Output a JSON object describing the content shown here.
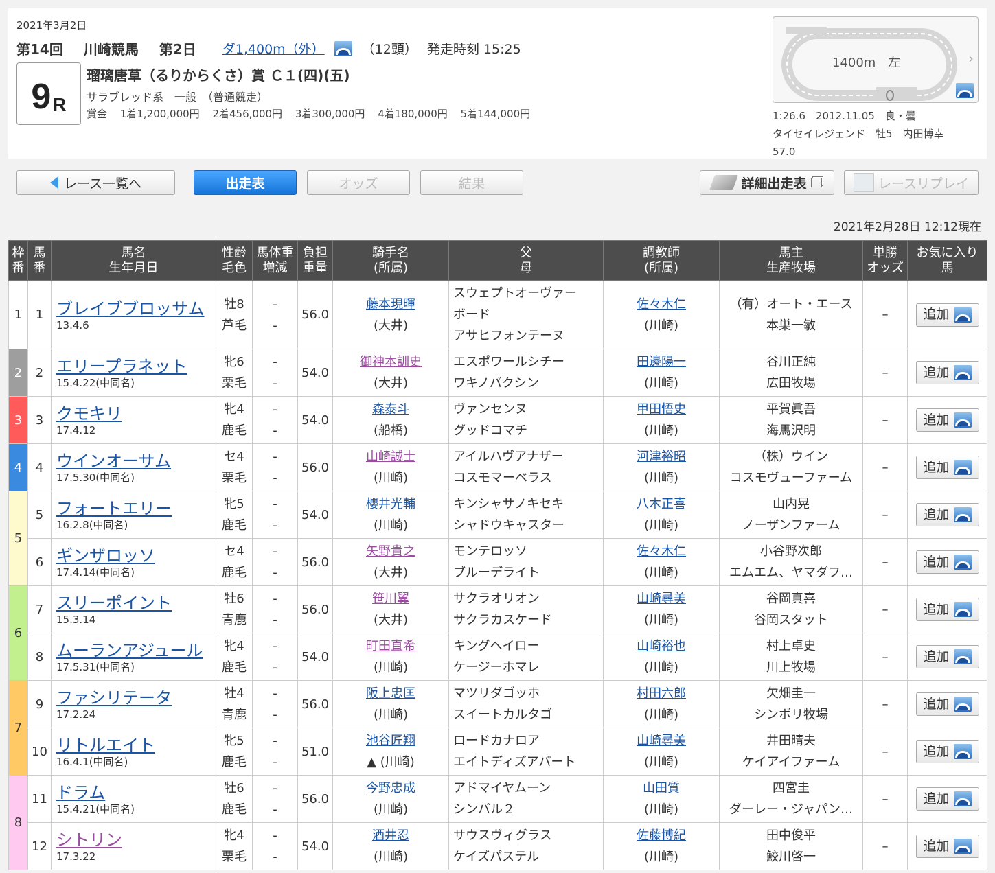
{
  "race": {
    "date": "2021年3月2日",
    "kai": "第14回",
    "venue": "川崎競馬",
    "day": "第2日",
    "distance": "ダ1,400m（外）",
    "count": "（12頭）",
    "post": "発走時刻 15:25",
    "number": "9",
    "r": "R",
    "name": "瑠璃唐草（るりからくさ）賞 Ｃ１(四)(五)",
    "class": "サラブレッド系　一般　（普通競走）",
    "prize_label": "賞金",
    "prizes": [
      "1着1,200,000円",
      "2着456,000円",
      "3着300,000円",
      "4着180,000円",
      "5着144,000円"
    ]
  },
  "course": {
    "label": "1400m　左",
    "record_line1": "1:26.6　2012.11.05　良・曇",
    "record_line2": "タイセイレジェンド　牡5　内田博幸",
    "record_line3": "57.0"
  },
  "nav": {
    "back": "レース一覧へ",
    "entries": "出走表",
    "odds": "オッズ",
    "result": "結果",
    "detail": "詳細出走表",
    "replay": "レースリプレイ"
  },
  "updated": "2021年2月28日 12:12現在",
  "headers": {
    "waku": [
      "枠",
      "番"
    ],
    "uma": [
      "馬",
      "番"
    ],
    "name": [
      "馬名",
      "生年月日"
    ],
    "sex": [
      "性齢",
      "毛色"
    ],
    "weight": [
      "馬体重",
      "増減"
    ],
    "burden": [
      "負担",
      "重量"
    ],
    "jockey": [
      "騎手名",
      "(所属)"
    ],
    "sire": [
      "父",
      "母"
    ],
    "trainer": [
      "調教師",
      "(所属)"
    ],
    "owner": [
      "馬主",
      "生産牧場"
    ],
    "odds": [
      "単勝",
      "オッズ"
    ],
    "fav": [
      "お気に入り",
      "馬"
    ]
  },
  "add_label": "追加",
  "colors": {
    "frame1": "#ffffff",
    "frame2": "#9e9e9e",
    "frame3": "#ff5b5b",
    "frame4": "#3a8be0",
    "frame5": "#fffacd",
    "frame6": "#c3f08e",
    "frame7": "#ffc966",
    "frame8": "#ffc9f0",
    "link": "#1a55a5",
    "visited": "#9b4ba0",
    "header_bg": "#4d4d4d"
  },
  "frames": [
    {
      "waku": "1",
      "span": 1
    },
    {
      "waku": "2",
      "span": 1
    },
    {
      "waku": "3",
      "span": 1
    },
    {
      "waku": "4",
      "span": 1
    },
    {
      "waku": "5",
      "span": 2
    },
    {
      "waku": "6",
      "span": 2
    },
    {
      "waku": "7",
      "span": 2
    },
    {
      "waku": "8",
      "span": 2
    }
  ],
  "horses": [
    {
      "num": "1",
      "name": "ブレイブブロッサム",
      "birth": "13.4.6",
      "sex": "牡8",
      "coat": "芦毛",
      "wt": "-",
      "diff": "-",
      "burden": "56.0",
      "jockey": "藤本現暉",
      "jaff": "(大井)",
      "jv": false,
      "sire": "スウェプトオーヴァー",
      "sire2": "ボード",
      "dam": "アサヒフォンテーヌ",
      "trainer": "佐々木仁",
      "taff": "(川崎)",
      "owner": "（有）オート・エース",
      "breeder": "本巣一敏",
      "odds": "–",
      "nv": false
    },
    {
      "num": "2",
      "name": "エリープラネット",
      "birth": "15.4.22(中同名)",
      "sex": "牝6",
      "coat": "栗毛",
      "wt": "-",
      "diff": "-",
      "burden": "54.0",
      "jockey": "御神本訓史",
      "jaff": "(大井)",
      "jv": true,
      "sire": "エスポワールシチー",
      "sire2": "",
      "dam": "ワキノバクシン",
      "trainer": "田邊陽一",
      "taff": "(川崎)",
      "owner": "谷川正純",
      "breeder": "広田牧場",
      "odds": "–",
      "nv": false
    },
    {
      "num": "3",
      "name": "クモキリ",
      "birth": "17.4.12",
      "sex": "牝4",
      "coat": "鹿毛",
      "wt": "-",
      "diff": "-",
      "burden": "54.0",
      "jockey": "森泰斗",
      "jaff": "(船橋)",
      "jv": false,
      "sire": "ヴァンセンヌ",
      "sire2": "",
      "dam": "グッドコマチ",
      "trainer": "甲田悟史",
      "taff": "(川崎)",
      "owner": "平賀眞吾",
      "breeder": "海馬沢明",
      "odds": "–",
      "nv": false
    },
    {
      "num": "4",
      "name": "ウインオーサム",
      "birth": "17.5.30(中同名)",
      "sex": "セ4",
      "coat": "栗毛",
      "wt": "-",
      "diff": "-",
      "burden": "56.0",
      "jockey": "山崎誠士",
      "jaff": "(川崎)",
      "jv": true,
      "sire": "アイルハヴアナザー",
      "sire2": "",
      "dam": "コスモマーベラス",
      "trainer": "河津裕昭",
      "taff": "(川崎)",
      "owner": "（株）ウイン",
      "breeder": "コスモヴューファーム",
      "odds": "–",
      "nv": false
    },
    {
      "num": "5",
      "name": "フォートエリー",
      "birth": "16.2.8(中同名)",
      "sex": "牝5",
      "coat": "鹿毛",
      "wt": "-",
      "diff": "-",
      "burden": "54.0",
      "jockey": "櫻井光輔",
      "jaff": "(川崎)",
      "jv": false,
      "sire": "キンシャサノキセキ",
      "sire2": "",
      "dam": "シャドウキャスター",
      "trainer": "八木正喜",
      "taff": "(川崎)",
      "owner": "山内晃",
      "breeder": "ノーザンファーム",
      "odds": "–",
      "nv": false
    },
    {
      "num": "6",
      "name": "ギンザロッソ",
      "birth": "17.4.14(中同名)",
      "sex": "セ4",
      "coat": "鹿毛",
      "wt": "-",
      "diff": "-",
      "burden": "56.0",
      "jockey": "矢野貴之",
      "jaff": "(大井)",
      "jv": true,
      "sire": "モンテロッソ",
      "sire2": "",
      "dam": "ブルーデライト",
      "trainer": "佐々木仁",
      "taff": "(川崎)",
      "owner": "小谷野次郎",
      "breeder": "エムエム、ヤマダフ…",
      "odds": "–",
      "nv": false
    },
    {
      "num": "7",
      "name": "スリーポイント",
      "birth": "15.3.14",
      "sex": "牡6",
      "coat": "青鹿",
      "wt": "-",
      "diff": "-",
      "burden": "56.0",
      "jockey": "笹川翼",
      "jaff": "(大井)",
      "jv": true,
      "sire": "サクラオリオン",
      "sire2": "",
      "dam": "サクラカスケード",
      "trainer": "山崎尋美",
      "taff": "(川崎)",
      "owner": "谷岡真喜",
      "breeder": "谷岡スタット",
      "odds": "–",
      "nv": false
    },
    {
      "num": "8",
      "name": "ムーランアジュール",
      "birth": "17.5.31(中同名)",
      "sex": "牝4",
      "coat": "鹿毛",
      "wt": "-",
      "diff": "-",
      "burden": "54.0",
      "jockey": "町田直希",
      "jaff": "(川崎)",
      "jv": true,
      "sire": "キングヘイロー",
      "sire2": "",
      "dam": "ケージーホマレ",
      "trainer": "山崎裕也",
      "taff": "(川崎)",
      "owner": "村上卓史",
      "breeder": "川上牧場",
      "odds": "–",
      "nv": false
    },
    {
      "num": "9",
      "name": "ファシリテータ",
      "birth": "17.2.24",
      "sex": "牡4",
      "coat": "青鹿",
      "wt": "-",
      "diff": "-",
      "burden": "56.0",
      "jockey": "阪上忠匡",
      "jaff": "(川崎)",
      "jv": false,
      "sire": "マツリダゴッホ",
      "sire2": "",
      "dam": "スイートカルタゴ",
      "trainer": "村田六郎",
      "taff": "(川崎)",
      "owner": "欠畑圭一",
      "breeder": "シンボリ牧場",
      "odds": "–",
      "nv": false
    },
    {
      "num": "10",
      "name": "リトルエイト",
      "birth": "16.4.1(中同名)",
      "sex": "牝5",
      "coat": "鹿毛",
      "wt": "-",
      "diff": "-",
      "burden": "51.0",
      "jockey": "池谷匠翔",
      "jaff": "▲ (川崎)",
      "jv": false,
      "sire": "ロードカナロア",
      "sire2": "",
      "dam": "エイトディズアパート",
      "trainer": "山崎尋美",
      "taff": "(川崎)",
      "owner": "井田晴夫",
      "breeder": "ケイアイファーム",
      "odds": "–",
      "nv": false
    },
    {
      "num": "11",
      "name": "ドラム",
      "birth": "15.4.21(中同名)",
      "sex": "牡6",
      "coat": "鹿毛",
      "wt": "-",
      "diff": "-",
      "burden": "56.0",
      "jockey": "今野忠成",
      "jaff": "(川崎)",
      "jv": false,
      "sire": "アドマイヤムーン",
      "sire2": "",
      "dam": "シンバル２",
      "trainer": "山田質",
      "taff": "(川崎)",
      "owner": "四宮圭",
      "breeder": "ダーレー・ジャパン…",
      "odds": "–",
      "nv": false
    },
    {
      "num": "12",
      "name": "シトリン",
      "birth": "17.3.22",
      "sex": "牝4",
      "coat": "栗毛",
      "wt": "-",
      "diff": "-",
      "burden": "54.0",
      "jockey": "酒井忍",
      "jaff": "(川崎)",
      "jv": false,
      "sire": "サウスヴィグラス",
      "sire2": "",
      "dam": "ケイズパステル",
      "trainer": "佐藤博紀",
      "taff": "(川崎)",
      "owner": "田中俊平",
      "breeder": "鮫川啓一",
      "odds": "–",
      "nv": true
    }
  ]
}
